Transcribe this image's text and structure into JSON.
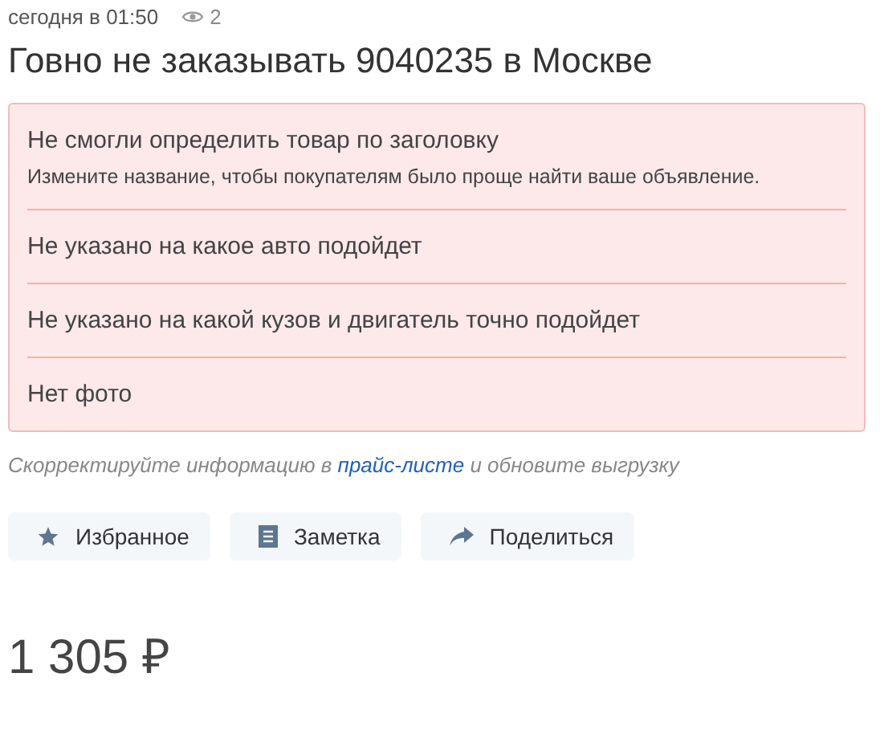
{
  "meta": {
    "date": "сегодня в 01:50",
    "views": "2"
  },
  "title": "Говно не заказывать 9040235 в Москве",
  "warnings": [
    {
      "text": "Не смогли определить товар по заголовку",
      "hint": "Измените название, чтобы покупателям было проще найти ваше объявление."
    },
    {
      "text": "Не указано на какое авто подойдет"
    },
    {
      "text": "Не указано на какой кузов и двигатель точно подойдет"
    },
    {
      "text": "Нет фото"
    }
  ],
  "note": {
    "before": "Скорректируйте информацию в",
    "link": "прайс-листе",
    "after": "и обновите выгрузку"
  },
  "buttons": [
    {
      "kind": "favorite",
      "label": "Избранное"
    },
    {
      "kind": "note",
      "label": "Заметка"
    },
    {
      "kind": "share",
      "label": "Поделиться"
    }
  ],
  "price": "1 305 ₽"
}
